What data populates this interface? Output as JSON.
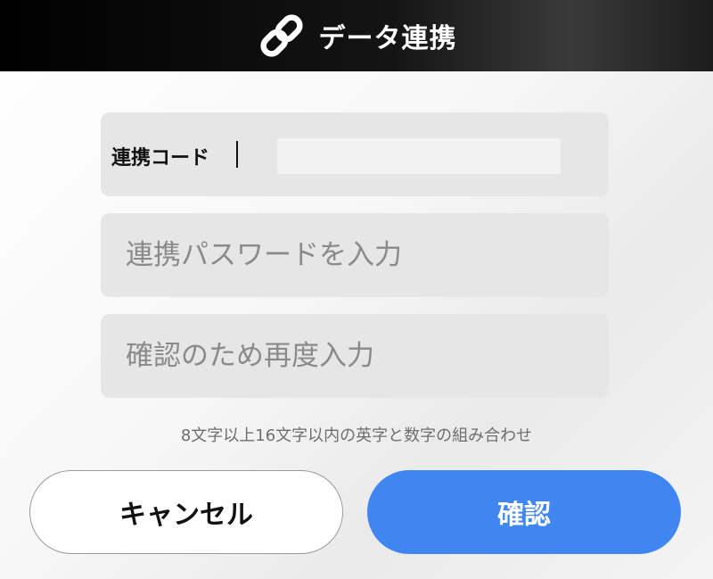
{
  "header": {
    "title": "データ連携",
    "icon": "link-icon"
  },
  "form": {
    "code_label": "連携コード",
    "code_value": "",
    "password_placeholder": "連携パスワードを入力",
    "password_value": "",
    "confirm_placeholder": "確認のため再度入力",
    "confirm_value": "",
    "hint": "8文字以上16文字以内の英字と数字の組み合わせ"
  },
  "buttons": {
    "cancel_label": "キャンセル",
    "confirm_label": "確認"
  },
  "colors": {
    "header_bg": "#000000",
    "field_bg": "#e6e6e6",
    "primary": "#3f86f0"
  }
}
